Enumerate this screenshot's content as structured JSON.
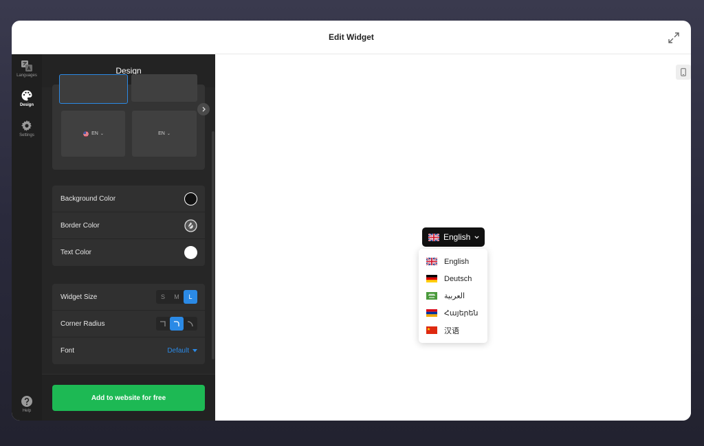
{
  "modal": {
    "title": "Edit Widget"
  },
  "rail": {
    "items": [
      {
        "label": "Languages",
        "icon": "translate-icon"
      },
      {
        "label": "Design",
        "icon": "palette-icon",
        "active": true
      },
      {
        "label": "Settings",
        "icon": "gear-icon"
      }
    ],
    "help_label": "Help"
  },
  "panel": {
    "title": "Design",
    "styles": {
      "tile_flag_label": "EN",
      "tile_plain_label": "EN"
    },
    "colors": {
      "background_label": "Background Color",
      "background_value": "#111111",
      "border_label": "Border Color",
      "text_label": "Text Color",
      "text_value": "#ffffff"
    },
    "widget_size": {
      "label": "Widget Size",
      "options": [
        "S",
        "M",
        "L"
      ],
      "selected": "L"
    },
    "corner_radius": {
      "label": "Corner Radius",
      "selected_index": 1
    },
    "font": {
      "label": "Font",
      "value": "Default"
    },
    "cta_label": "Add to website for free"
  },
  "preview": {
    "current_language": "English",
    "languages": [
      {
        "name": "English",
        "flag": "uk-flag-icon"
      },
      {
        "name": "Deutsch",
        "flag": "germany-flag-icon"
      },
      {
        "name": "العربية",
        "flag": "saudi-flag-icon"
      },
      {
        "name": "Հայերեն",
        "flag": "armenia-flag-icon"
      },
      {
        "name": "汉语",
        "flag": "china-flag-icon"
      }
    ]
  },
  "colors": {
    "accent": "#2b8ae6",
    "cta": "#1db954"
  }
}
